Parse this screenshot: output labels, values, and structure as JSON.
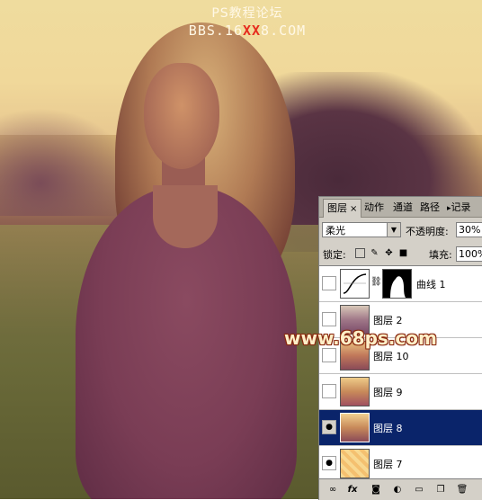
{
  "photo": {
    "title": "PS教程论坛",
    "url_prefix": "BBS.16",
    "url_highlight": "XX",
    "url_suffix": "8.COM",
    "watermark": "www.68ps.com"
  },
  "panel": {
    "tabs": {
      "layers": "图层",
      "close": "×",
      "actions": "动作",
      "channels": "通道",
      "paths": "路径",
      "history": "记录"
    },
    "blend_mode": "柔光",
    "opacity_label": "不透明度:",
    "opacity_value": "30%",
    "lock_label": "锁定:",
    "fill_label": "填充:",
    "fill_value": "100%",
    "layers": [
      {
        "name": "曲线 1",
        "visible": false,
        "selected": false,
        "type": "adjustment"
      },
      {
        "name": "图层 2",
        "visible": false,
        "selected": false,
        "type": "image"
      },
      {
        "name": "图层 10",
        "visible": false,
        "selected": false,
        "type": "image"
      },
      {
        "name": "图层 9",
        "visible": false,
        "selected": false,
        "type": "image"
      },
      {
        "name": "图层 8",
        "visible": true,
        "selected": true,
        "type": "image"
      },
      {
        "name": "图层 7",
        "visible": true,
        "selected": false,
        "type": "image"
      }
    ],
    "eye_glyph": "●",
    "bottom_icons": [
      "link-icon",
      "fx-icon",
      "mask-icon",
      "adjustment-icon",
      "folder-icon",
      "new-layer-icon",
      "trash-icon"
    ]
  },
  "colors": {
    "selection": "#0a246a",
    "panel_bg": "#d4d0c8",
    "watermark": "#ffefc8"
  }
}
